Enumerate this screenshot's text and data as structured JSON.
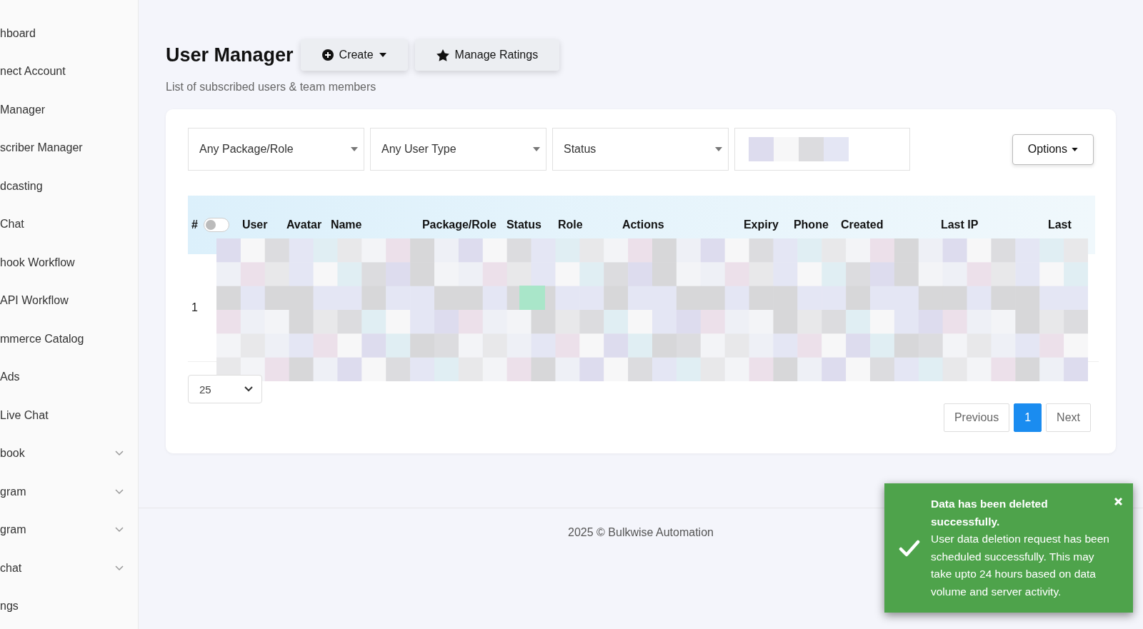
{
  "sidebar": {
    "items": [
      {
        "label": "hboard",
        "kind": "link"
      },
      {
        "label": "nect Account",
        "kind": "link"
      },
      {
        "label": "Manager",
        "kind": "link"
      },
      {
        "label": "scriber Manager",
        "kind": "link"
      },
      {
        "label": "dcasting",
        "kind": "link"
      },
      {
        "label": "Chat",
        "kind": "link"
      },
      {
        "label": "hook Workflow",
        "kind": "link"
      },
      {
        "label": "API Workflow",
        "kind": "link"
      },
      {
        "label": "mmerce Catalog",
        "kind": "link"
      },
      {
        "label": "Ads",
        "kind": "link"
      },
      {
        "label": "Live Chat",
        "kind": "link"
      },
      {
        "label": "book",
        "kind": "group"
      },
      {
        "label": "gram",
        "kind": "group"
      },
      {
        "label": "gram",
        "kind": "group"
      },
      {
        "label": "chat",
        "kind": "group"
      },
      {
        "label": "ngs",
        "kind": "link"
      }
    ]
  },
  "header": {
    "title": "User Manager",
    "buttons": [
      {
        "label": "Create",
        "kind": "dropdown"
      },
      {
        "label": "Manage Ratings",
        "kind": "star"
      }
    ],
    "subtitle": "List of subscribed users & team members"
  },
  "filters": [
    {
      "label": "Any Package/Role"
    },
    {
      "label": "Any User Type"
    },
    {
      "label": "Status"
    }
  ],
  "options_button": "Options",
  "table": {
    "select_all_toggle": {
      "on": false
    },
    "columns": [
      "#",
      "User",
      "Avatar",
      "Name",
      "Package/Role",
      "Status",
      "Role",
      "Actions",
      "Expiry",
      "Phone",
      "Created",
      "Last IP",
      "Last"
    ],
    "rows": [
      {
        "number": "1"
      }
    ]
  },
  "page_size": "25",
  "pagination": [
    {
      "label": "Previous",
      "selected": false
    },
    {
      "label": "1",
      "selected": true
    },
    {
      "label": "Next",
      "selected": false
    }
  ],
  "footer": "2025 © Bulkwise Automation",
  "toast": {
    "title": "Data has been deleted successfully.",
    "message": "User data deletion request has been scheduled successfully. This may take upto 24 hours based on data volume and server activity."
  }
}
